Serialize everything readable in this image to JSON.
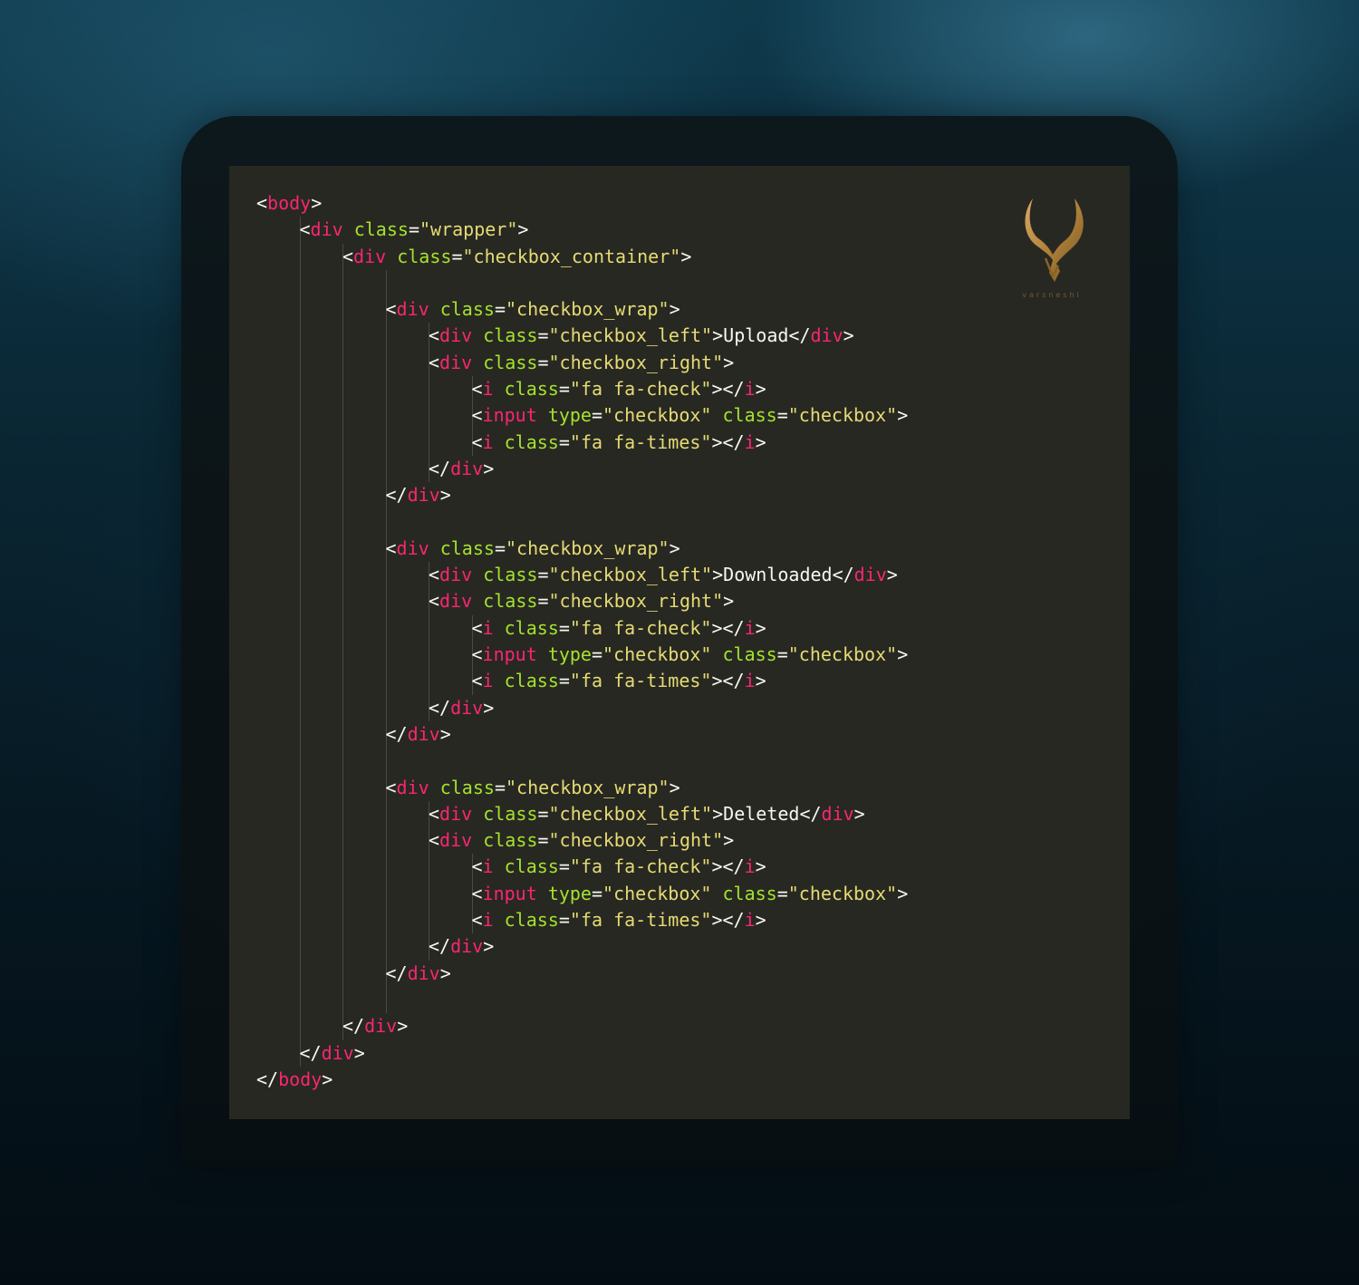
{
  "code_lines": [
    {
      "indent": 0,
      "tokens": [
        [
          "punc",
          "<"
        ],
        [
          "tag",
          "body"
        ],
        [
          "punc",
          ">"
        ]
      ]
    },
    {
      "indent": 1,
      "tokens": [
        [
          "punc",
          "<"
        ],
        [
          "tag",
          "div"
        ],
        [
          "txt",
          " "
        ],
        [
          "attr",
          "class"
        ],
        [
          "punc",
          "="
        ],
        [
          "str",
          "\"wrapper\""
        ],
        [
          "punc",
          ">"
        ]
      ]
    },
    {
      "indent": 2,
      "tokens": [
        [
          "punc",
          "<"
        ],
        [
          "tag",
          "div"
        ],
        [
          "txt",
          " "
        ],
        [
          "attr",
          "class"
        ],
        [
          "punc",
          "="
        ],
        [
          "str",
          "\"checkbox_container\""
        ],
        [
          "punc",
          ">"
        ]
      ]
    },
    {
      "indent": 3,
      "tokens": []
    },
    {
      "indent": 3,
      "tokens": [
        [
          "punc",
          "<"
        ],
        [
          "tag",
          "div"
        ],
        [
          "txt",
          " "
        ],
        [
          "attr",
          "class"
        ],
        [
          "punc",
          "="
        ],
        [
          "str",
          "\"checkbox_wrap\""
        ],
        [
          "punc",
          ">"
        ]
      ]
    },
    {
      "indent": 4,
      "tokens": [
        [
          "punc",
          "<"
        ],
        [
          "tag",
          "div"
        ],
        [
          "txt",
          " "
        ],
        [
          "attr",
          "class"
        ],
        [
          "punc",
          "="
        ],
        [
          "str",
          "\"checkbox_left\""
        ],
        [
          "punc",
          ">"
        ],
        [
          "txt",
          "Upload"
        ],
        [
          "punc",
          "</"
        ],
        [
          "tag",
          "div"
        ],
        [
          "punc",
          ">"
        ]
      ]
    },
    {
      "indent": 4,
      "tokens": [
        [
          "punc",
          "<"
        ],
        [
          "tag",
          "div"
        ],
        [
          "txt",
          " "
        ],
        [
          "attr",
          "class"
        ],
        [
          "punc",
          "="
        ],
        [
          "str",
          "\"checkbox_right\""
        ],
        [
          "punc",
          ">"
        ]
      ]
    },
    {
      "indent": 5,
      "tokens": [
        [
          "punc",
          "<"
        ],
        [
          "tag",
          "i"
        ],
        [
          "txt",
          " "
        ],
        [
          "attr",
          "class"
        ],
        [
          "punc",
          "="
        ],
        [
          "str",
          "\"fa fa-check\""
        ],
        [
          "punc",
          "></"
        ],
        [
          "tag",
          "i"
        ],
        [
          "punc",
          ">"
        ]
      ]
    },
    {
      "indent": 5,
      "tokens": [
        [
          "punc",
          "<"
        ],
        [
          "tag",
          "input"
        ],
        [
          "txt",
          " "
        ],
        [
          "attr",
          "type"
        ],
        [
          "punc",
          "="
        ],
        [
          "str",
          "\"checkbox\""
        ],
        [
          "txt",
          " "
        ],
        [
          "attr",
          "class"
        ],
        [
          "punc",
          "="
        ],
        [
          "str",
          "\"checkbox\""
        ],
        [
          "punc",
          ">"
        ]
      ]
    },
    {
      "indent": 5,
      "tokens": [
        [
          "punc",
          "<"
        ],
        [
          "tag",
          "i"
        ],
        [
          "txt",
          " "
        ],
        [
          "attr",
          "class"
        ],
        [
          "punc",
          "="
        ],
        [
          "str",
          "\"fa fa-times\""
        ],
        [
          "punc",
          "></"
        ],
        [
          "tag",
          "i"
        ],
        [
          "punc",
          ">"
        ]
      ]
    },
    {
      "indent": 4,
      "tokens": [
        [
          "punc",
          "</"
        ],
        [
          "tag",
          "div"
        ],
        [
          "punc",
          ">"
        ]
      ]
    },
    {
      "indent": 3,
      "tokens": [
        [
          "punc",
          "</"
        ],
        [
          "tag",
          "div"
        ],
        [
          "punc",
          ">"
        ]
      ]
    },
    {
      "indent": 3,
      "tokens": []
    },
    {
      "indent": 3,
      "tokens": [
        [
          "punc",
          "<"
        ],
        [
          "tag",
          "div"
        ],
        [
          "txt",
          " "
        ],
        [
          "attr",
          "class"
        ],
        [
          "punc",
          "="
        ],
        [
          "str",
          "\"checkbox_wrap\""
        ],
        [
          "punc",
          ">"
        ]
      ]
    },
    {
      "indent": 4,
      "tokens": [
        [
          "punc",
          "<"
        ],
        [
          "tag",
          "div"
        ],
        [
          "txt",
          " "
        ],
        [
          "attr",
          "class"
        ],
        [
          "punc",
          "="
        ],
        [
          "str",
          "\"checkbox_left\""
        ],
        [
          "punc",
          ">"
        ],
        [
          "txt",
          "Downloaded"
        ],
        [
          "punc",
          "</"
        ],
        [
          "tag",
          "div"
        ],
        [
          "punc",
          ">"
        ]
      ]
    },
    {
      "indent": 4,
      "tokens": [
        [
          "punc",
          "<"
        ],
        [
          "tag",
          "div"
        ],
        [
          "txt",
          " "
        ],
        [
          "attr",
          "class"
        ],
        [
          "punc",
          "="
        ],
        [
          "str",
          "\"checkbox_right\""
        ],
        [
          "punc",
          ">"
        ]
      ]
    },
    {
      "indent": 5,
      "tokens": [
        [
          "punc",
          "<"
        ],
        [
          "tag",
          "i"
        ],
        [
          "txt",
          " "
        ],
        [
          "attr",
          "class"
        ],
        [
          "punc",
          "="
        ],
        [
          "str",
          "\"fa fa-check\""
        ],
        [
          "punc",
          "></"
        ],
        [
          "tag",
          "i"
        ],
        [
          "punc",
          ">"
        ]
      ]
    },
    {
      "indent": 5,
      "tokens": [
        [
          "punc",
          "<"
        ],
        [
          "tag",
          "input"
        ],
        [
          "txt",
          " "
        ],
        [
          "attr",
          "type"
        ],
        [
          "punc",
          "="
        ],
        [
          "str",
          "\"checkbox\""
        ],
        [
          "txt",
          " "
        ],
        [
          "attr",
          "class"
        ],
        [
          "punc",
          "="
        ],
        [
          "str",
          "\"checkbox\""
        ],
        [
          "punc",
          ">"
        ]
      ]
    },
    {
      "indent": 5,
      "tokens": [
        [
          "punc",
          "<"
        ],
        [
          "tag",
          "i"
        ],
        [
          "txt",
          " "
        ],
        [
          "attr",
          "class"
        ],
        [
          "punc",
          "="
        ],
        [
          "str",
          "\"fa fa-times\""
        ],
        [
          "punc",
          "></"
        ],
        [
          "tag",
          "i"
        ],
        [
          "punc",
          ">"
        ]
      ]
    },
    {
      "indent": 4,
      "tokens": [
        [
          "punc",
          "</"
        ],
        [
          "tag",
          "div"
        ],
        [
          "punc",
          ">"
        ]
      ]
    },
    {
      "indent": 3,
      "tokens": [
        [
          "punc",
          "</"
        ],
        [
          "tag",
          "div"
        ],
        [
          "punc",
          ">"
        ]
      ]
    },
    {
      "indent": 3,
      "tokens": []
    },
    {
      "indent": 3,
      "tokens": [
        [
          "punc",
          "<"
        ],
        [
          "tag",
          "div"
        ],
        [
          "txt",
          " "
        ],
        [
          "attr",
          "class"
        ],
        [
          "punc",
          "="
        ],
        [
          "str",
          "\"checkbox_wrap\""
        ],
        [
          "punc",
          ">"
        ]
      ]
    },
    {
      "indent": 4,
      "tokens": [
        [
          "punc",
          "<"
        ],
        [
          "tag",
          "div"
        ],
        [
          "txt",
          " "
        ],
        [
          "attr",
          "class"
        ],
        [
          "punc",
          "="
        ],
        [
          "str",
          "\"checkbox_left\""
        ],
        [
          "punc",
          ">"
        ],
        [
          "txt",
          "Deleted"
        ],
        [
          "punc",
          "</"
        ],
        [
          "tag",
          "div"
        ],
        [
          "punc",
          ">"
        ]
      ]
    },
    {
      "indent": 4,
      "tokens": [
        [
          "punc",
          "<"
        ],
        [
          "tag",
          "div"
        ],
        [
          "txt",
          " "
        ],
        [
          "attr",
          "class"
        ],
        [
          "punc",
          "="
        ],
        [
          "str",
          "\"checkbox_right\""
        ],
        [
          "punc",
          ">"
        ]
      ]
    },
    {
      "indent": 5,
      "tokens": [
        [
          "punc",
          "<"
        ],
        [
          "tag",
          "i"
        ],
        [
          "txt",
          " "
        ],
        [
          "attr",
          "class"
        ],
        [
          "punc",
          "="
        ],
        [
          "str",
          "\"fa fa-check\""
        ],
        [
          "punc",
          "></"
        ],
        [
          "tag",
          "i"
        ],
        [
          "punc",
          ">"
        ]
      ]
    },
    {
      "indent": 5,
      "tokens": [
        [
          "punc",
          "<"
        ],
        [
          "tag",
          "input"
        ],
        [
          "txt",
          " "
        ],
        [
          "attr",
          "type"
        ],
        [
          "punc",
          "="
        ],
        [
          "str",
          "\"checkbox\""
        ],
        [
          "txt",
          " "
        ],
        [
          "attr",
          "class"
        ],
        [
          "punc",
          "="
        ],
        [
          "str",
          "\"checkbox\""
        ],
        [
          "punc",
          ">"
        ]
      ]
    },
    {
      "indent": 5,
      "tokens": [
        [
          "punc",
          "<"
        ],
        [
          "tag",
          "i"
        ],
        [
          "txt",
          " "
        ],
        [
          "attr",
          "class"
        ],
        [
          "punc",
          "="
        ],
        [
          "str",
          "\"fa fa-times\""
        ],
        [
          "punc",
          "></"
        ],
        [
          "tag",
          "i"
        ],
        [
          "punc",
          ">"
        ]
      ]
    },
    {
      "indent": 4,
      "tokens": [
        [
          "punc",
          "</"
        ],
        [
          "tag",
          "div"
        ],
        [
          "punc",
          ">"
        ]
      ]
    },
    {
      "indent": 3,
      "tokens": [
        [
          "punc",
          "</"
        ],
        [
          "tag",
          "div"
        ],
        [
          "punc",
          ">"
        ]
      ]
    },
    {
      "indent": 3,
      "tokens": []
    },
    {
      "indent": 2,
      "tokens": [
        [
          "punc",
          "</"
        ],
        [
          "tag",
          "div"
        ],
        [
          "punc",
          ">"
        ]
      ]
    },
    {
      "indent": 1,
      "tokens": [
        [
          "punc",
          "</"
        ],
        [
          "tag",
          "div"
        ],
        [
          "punc",
          ">"
        ]
      ]
    },
    {
      "indent": 0,
      "tokens": [
        [
          "punc",
          "</"
        ],
        [
          "tag",
          "body"
        ],
        [
          "punc",
          ">"
        ]
      ]
    }
  ],
  "logo": {
    "text": "varsneshi",
    "icon": "antler-emblem-icon",
    "color": "#b8863b"
  },
  "colors": {
    "editor_bg": "#272822",
    "tag": "#f92672",
    "attribute": "#a6e22e",
    "string": "#e6db74",
    "text": "#f8f8f2"
  }
}
